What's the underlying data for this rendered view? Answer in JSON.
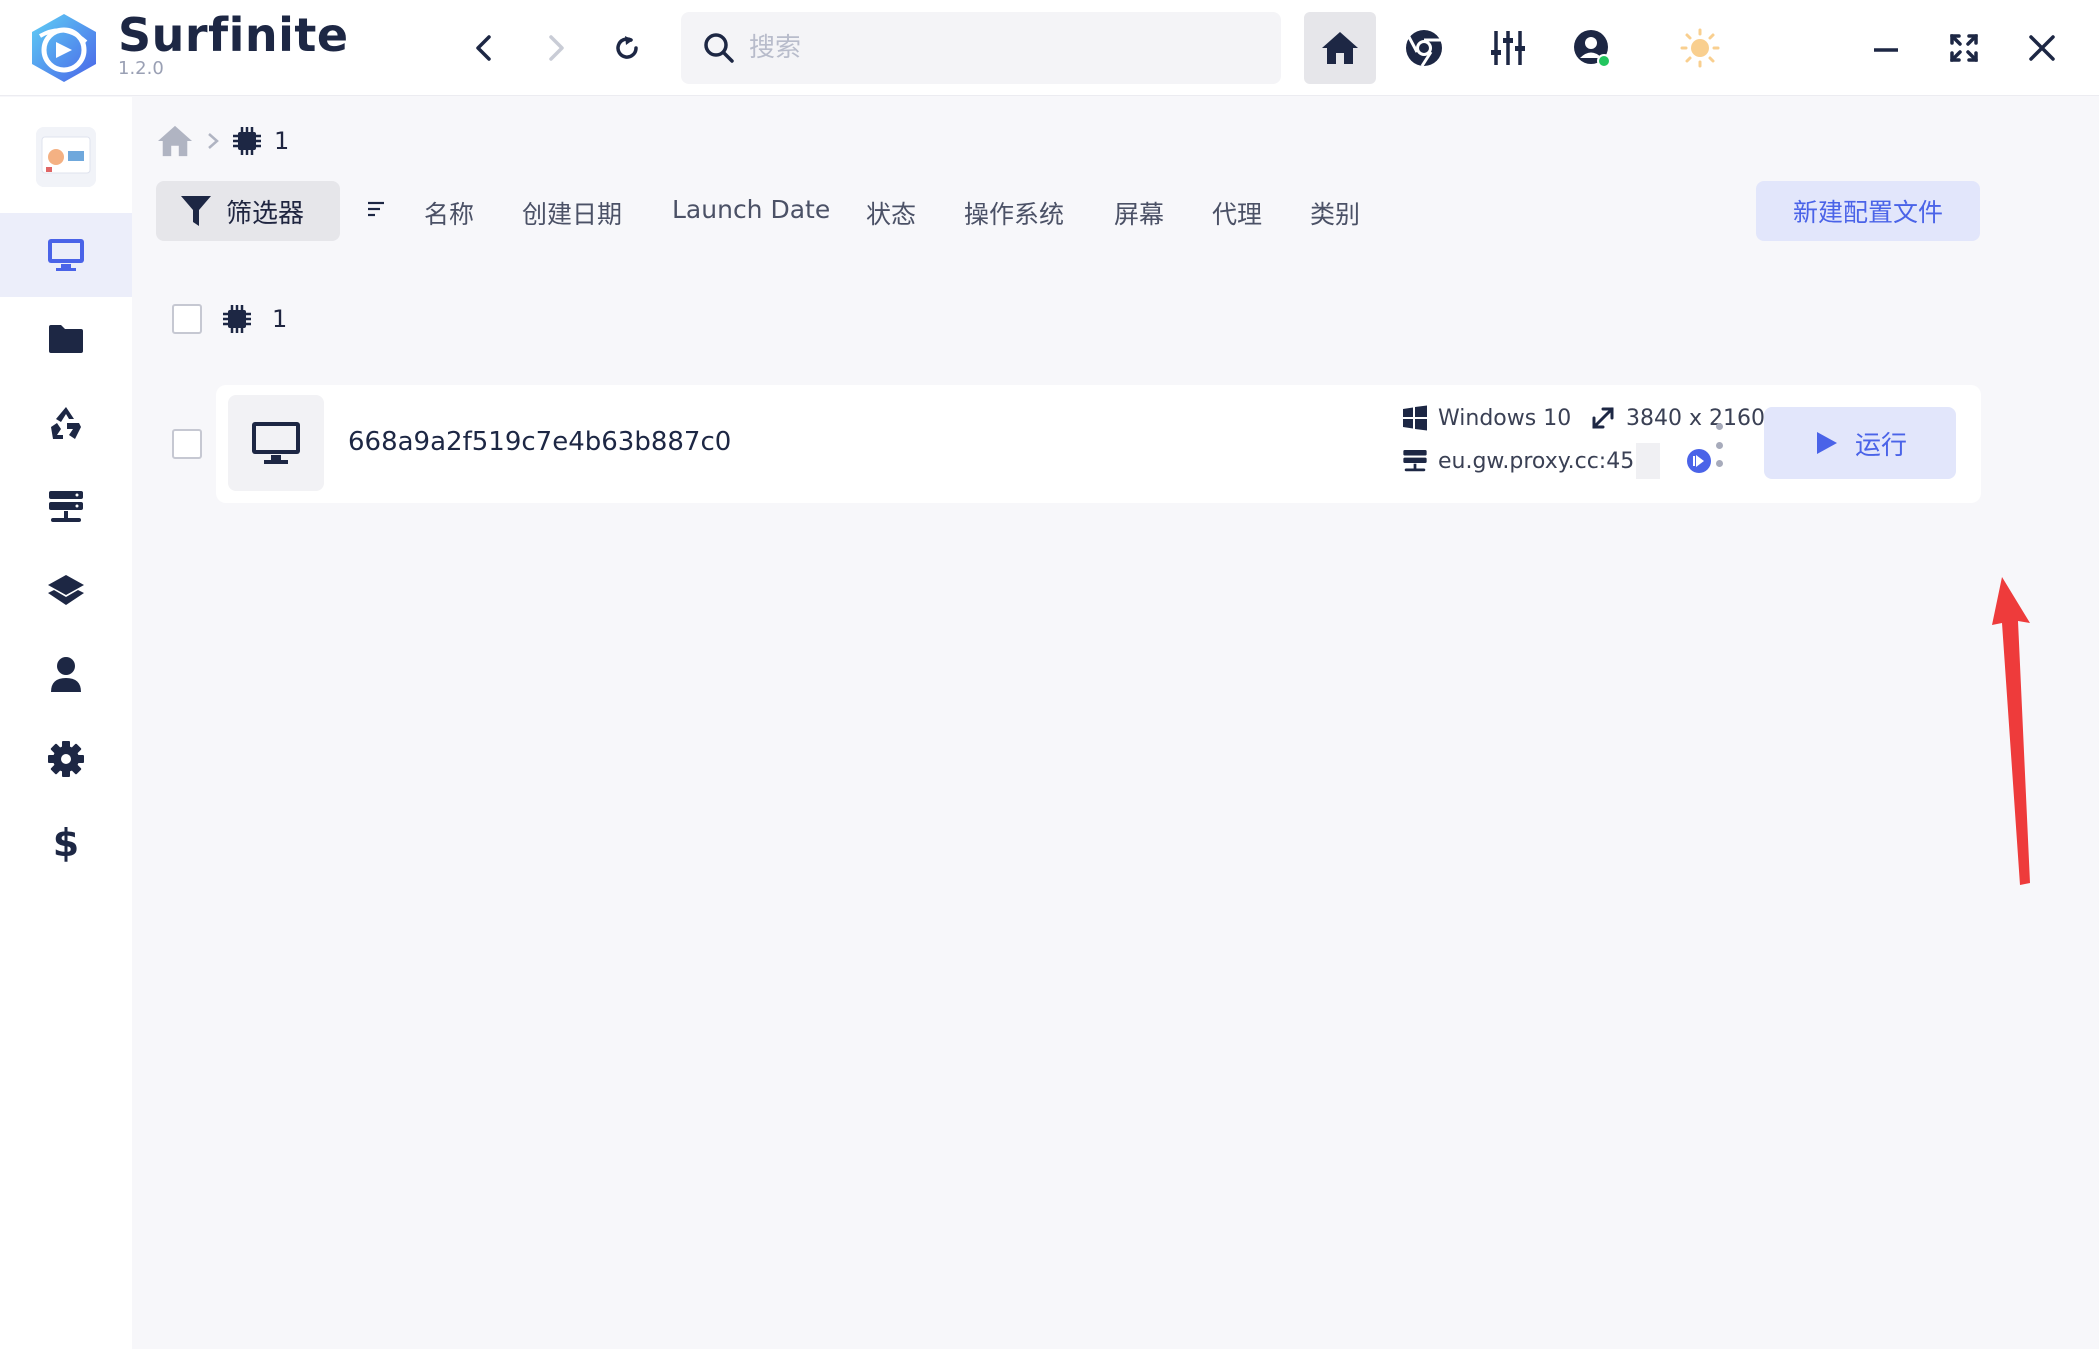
{
  "app": {
    "title": "Surfinite",
    "version": "1.2.0"
  },
  "search": {
    "placeholder": "搜索",
    "value": ""
  },
  "breadcrumb": {
    "current": "1"
  },
  "toolbar": {
    "filter_label": "筛选器",
    "columns": [
      "名称",
      "创建日期",
      "Launch Date",
      "状态",
      "操作系统",
      "屏幕",
      "代理",
      "类别"
    ],
    "new_profile_label": "新建配置文件"
  },
  "group": {
    "label": "1"
  },
  "profile": {
    "name": "668a9a2f519c7e4b63b887c0",
    "os": "Windows 10",
    "resolution": "3840 x 2160",
    "proxy": "eu.gw.proxy.cc:45",
    "run_label": "运行"
  },
  "colors": {
    "accent": "#4a63e8",
    "accent_bg": "#e2e6fb",
    "status_online": "#22c55e",
    "annotation_arrow": "#ee3b3b"
  }
}
